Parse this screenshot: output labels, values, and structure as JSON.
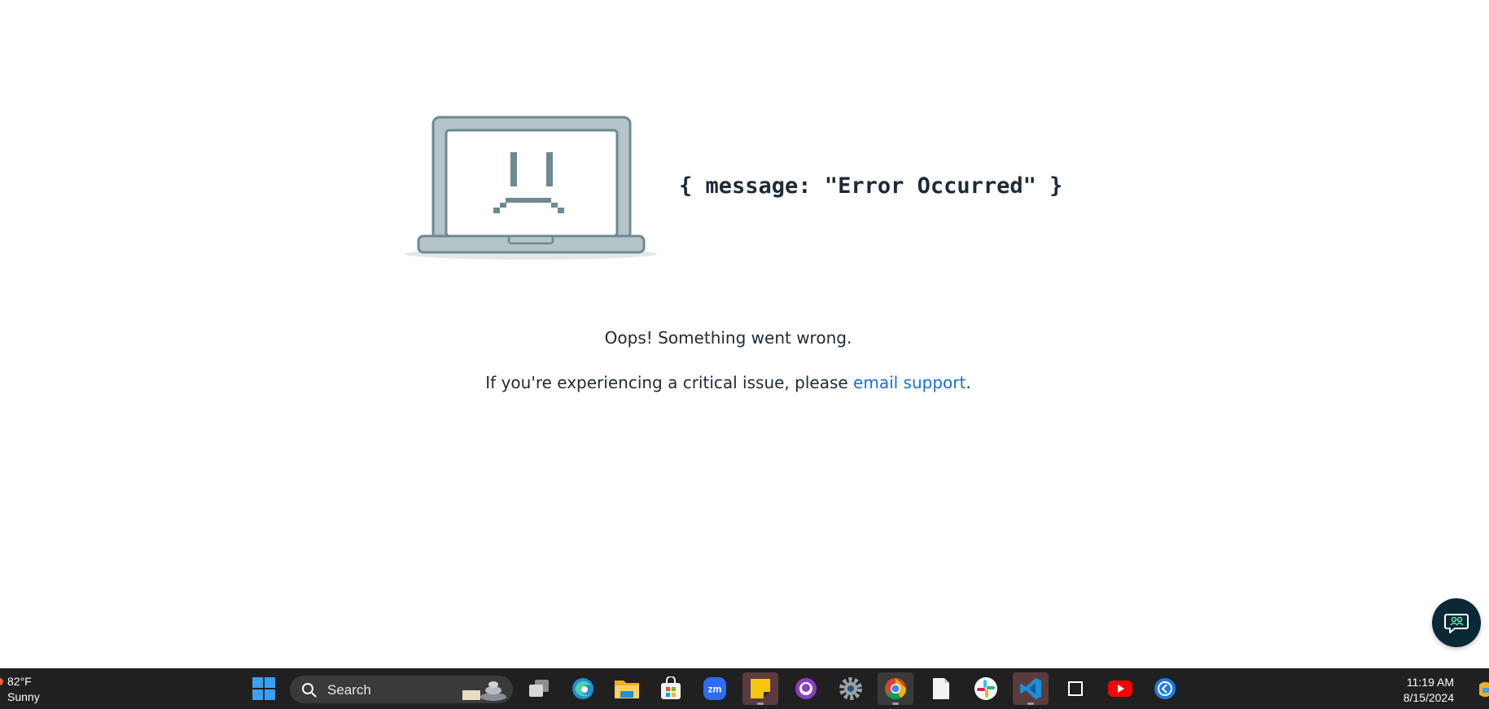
{
  "error": {
    "code_text": "{ message: \"Error Occurred\" }",
    "heading": "Oops! Something went wrong.",
    "detail_prefix": "If you're experiencing a critical issue, please ",
    "link_text": "email support",
    "detail_suffix": "."
  },
  "colors": {
    "text": "#1d2b36",
    "link": "#1a6ed8",
    "chat_button": "#0b2836",
    "taskbar": "#202020"
  },
  "chat_widget": {
    "icon": "chat-support-icon"
  },
  "taskbar": {
    "weather": {
      "temp": "82°F",
      "condition": "Sunny"
    },
    "search_label": "Search",
    "apps": [
      {
        "name": "start",
        "icon": "windows-start-icon"
      },
      {
        "name": "task-view",
        "icon": "task-view-icon"
      },
      {
        "name": "edge",
        "icon": "edge-icon"
      },
      {
        "name": "file-explorer",
        "icon": "folder-icon"
      },
      {
        "name": "store",
        "icon": "store-icon"
      },
      {
        "name": "zoom",
        "icon": "zoom-icon",
        "text": "zm"
      },
      {
        "name": "sticky-notes",
        "icon": "sticky-notes-icon"
      },
      {
        "name": "github",
        "icon": "github-icon"
      },
      {
        "name": "settings",
        "icon": "gear-icon"
      },
      {
        "name": "chrome",
        "icon": "chrome-icon"
      },
      {
        "name": "notepad",
        "icon": "file-icon"
      },
      {
        "name": "slack",
        "icon": "slack-icon"
      },
      {
        "name": "vscode",
        "icon": "vscode-icon"
      },
      {
        "name": "window",
        "icon": "square-icon"
      },
      {
        "name": "youtube",
        "icon": "youtube-icon"
      },
      {
        "name": "app",
        "icon": "blue-circle-app-icon"
      }
    ],
    "clock": {
      "time": "11:19 AM",
      "date": "8/15/2024"
    }
  }
}
